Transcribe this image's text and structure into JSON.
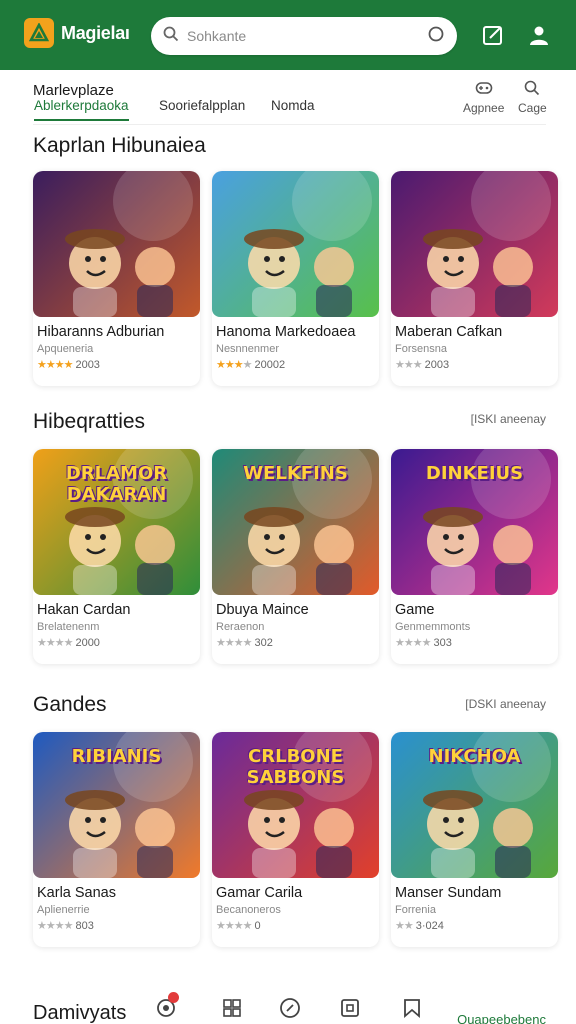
{
  "app": {
    "name": "Magielaı",
    "brand_color": "#1e7a3a",
    "accent_color": "#f2a21c"
  },
  "search": {
    "placeholder": "Sohkante"
  },
  "nav": {
    "title": "Marlevplaze",
    "tabs": [
      {
        "label": "Ablerkerpdaoka",
        "active": true
      },
      {
        "label": "Sooriefalpplan",
        "active": false
      },
      {
        "label": "Nomda",
        "active": false
      }
    ],
    "actions": [
      {
        "label": "Agpnee",
        "icon": "gamepad-icon"
      },
      {
        "label": "Cage",
        "icon": "search-icon"
      }
    ]
  },
  "sections": [
    {
      "title": "Kaprlan Hibunaiea",
      "see_all": "",
      "items": [
        {
          "name": "Hibaranns Adburian",
          "sub": "Apqueneria",
          "stars": "★★★★",
          "stars_grey": "",
          "rating": "2003",
          "colors": [
            "#3a1d5e",
            "#c2592a"
          ]
        },
        {
          "name": "Hanoma Markedoaea",
          "sub": "Nesnnenmer",
          "stars": "★★★",
          "stars_grey": "★",
          "rating": "20002",
          "colors": [
            "#4aa0e0",
            "#58c04a"
          ]
        },
        {
          "name": "Maberan Cafkan",
          "sub": "Forsensna",
          "stars": "",
          "stars_grey": "★★★",
          "rating": "2003",
          "colors": [
            "#4a1a70",
            "#d23a5a"
          ]
        }
      ]
    },
    {
      "title": "Hibeqratties",
      "see_all": "[ISKI aneenay",
      "items": [
        {
          "name": "Hakan Cardan",
          "sub": "Brelatenenm",
          "stars": "",
          "stars_grey": "★★★★",
          "rating": "2000",
          "colors": [
            "#f0a019",
            "#2f8e3a"
          ],
          "art_text": "DRLAMOR DAKARAN"
        },
        {
          "name": "Dbuya Maince",
          "sub": "Reraenon",
          "stars": "",
          "stars_grey": "★★★★",
          "rating": "302",
          "colors": [
            "#1f8a78",
            "#e25a2a"
          ],
          "art_text": "WELKFINS"
        },
        {
          "name": "Game",
          "sub": "Genmemmonts",
          "stars": "",
          "stars_grey": "★★★★",
          "rating": "303",
          "colors": [
            "#3a1a90",
            "#e2368a"
          ],
          "art_text": "DINKEIUS"
        }
      ]
    },
    {
      "title": "Gandes",
      "see_all": "[DSKI aneenay",
      "items": [
        {
          "name": "Karla Sanas",
          "sub": "Aplienerrie",
          "stars": "",
          "stars_grey": "★★★★",
          "rating": "803",
          "colors": [
            "#1e5ac0",
            "#f07a2a"
          ],
          "art_text": "RIBIANIS"
        },
        {
          "name": "Gamar Carila",
          "sub": "Becanoneros",
          "stars": "",
          "stars_grey": "★★★★",
          "rating": "0",
          "colors": [
            "#6a2a9a",
            "#e2402a"
          ],
          "art_text": "CRLBONE SABBONS"
        },
        {
          "name": "Manser Sundam",
          "sub": "Forrenia",
          "stars": "",
          "stars_grey": "★★",
          "rating": "3·024",
          "colors": [
            "#2a90d0",
            "#58a83a"
          ],
          "art_text": "NIKCHOA"
        }
      ]
    }
  ],
  "bottom": {
    "brand": "Damivyats",
    "icons": [
      "gamepad-icon",
      "grid-icon",
      "compass-icon",
      "square-icon",
      "bookmark-icon"
    ],
    "right_label": "Quapeebebenc"
  }
}
